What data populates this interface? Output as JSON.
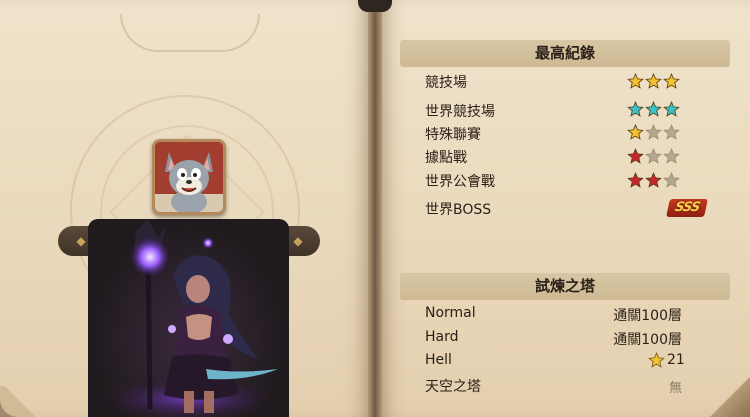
{
  "records": {
    "title": "最高紀錄",
    "rows": [
      {
        "label": "競技場",
        "stars": [
          "gold",
          "gold",
          "gold"
        ]
      },
      {
        "label": "世界競技場",
        "stars": [
          "teal",
          "teal",
          "teal"
        ]
      },
      {
        "label": "特殊聯賽",
        "stars": [
          "gold",
          "empty",
          "empty"
        ]
      },
      {
        "label": "據點戰",
        "stars": [
          "red",
          "empty",
          "empty"
        ]
      },
      {
        "label": "世界公會戰",
        "stars": [
          "red",
          "red",
          "empty"
        ]
      },
      {
        "label": "世界BOSS",
        "badge": "SSS"
      }
    ]
  },
  "trial": {
    "title": "試煉之塔",
    "rows": [
      {
        "label": "Normal",
        "value": "通關100層"
      },
      {
        "label": "Hard",
        "value": "通關100層"
      },
      {
        "label": "Hell",
        "value": "21"
      },
      {
        "label": "天空之塔",
        "value": "無"
      }
    ]
  },
  "colors": {
    "gold": "#f2c230",
    "teal": "#38c3c9",
    "red": "#c4282c",
    "empty": "#b6a88f"
  },
  "icons": {
    "avatar": "cartoon-cat-avatar",
    "hero": "dark-sorceress-hero",
    "arrow_left": "diamond-arrow-left-icon",
    "arrow_right": "diamond-arrow-right-icon"
  }
}
